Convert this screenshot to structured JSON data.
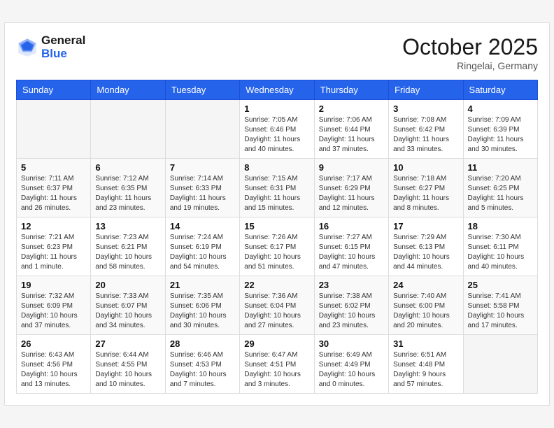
{
  "header": {
    "logo_line1": "General",
    "logo_line2": "Blue",
    "month_title": "October 2025",
    "location": "Ringelai, Germany"
  },
  "weekdays": [
    "Sunday",
    "Monday",
    "Tuesday",
    "Wednesday",
    "Thursday",
    "Friday",
    "Saturday"
  ],
  "weeks": [
    [
      {
        "day": "",
        "info": ""
      },
      {
        "day": "",
        "info": ""
      },
      {
        "day": "",
        "info": ""
      },
      {
        "day": "1",
        "info": "Sunrise: 7:05 AM\nSunset: 6:46 PM\nDaylight: 11 hours\nand 40 minutes."
      },
      {
        "day": "2",
        "info": "Sunrise: 7:06 AM\nSunset: 6:44 PM\nDaylight: 11 hours\nand 37 minutes."
      },
      {
        "day": "3",
        "info": "Sunrise: 7:08 AM\nSunset: 6:42 PM\nDaylight: 11 hours\nand 33 minutes."
      },
      {
        "day": "4",
        "info": "Sunrise: 7:09 AM\nSunset: 6:39 PM\nDaylight: 11 hours\nand 30 minutes."
      }
    ],
    [
      {
        "day": "5",
        "info": "Sunrise: 7:11 AM\nSunset: 6:37 PM\nDaylight: 11 hours\nand 26 minutes."
      },
      {
        "day": "6",
        "info": "Sunrise: 7:12 AM\nSunset: 6:35 PM\nDaylight: 11 hours\nand 23 minutes."
      },
      {
        "day": "7",
        "info": "Sunrise: 7:14 AM\nSunset: 6:33 PM\nDaylight: 11 hours\nand 19 minutes."
      },
      {
        "day": "8",
        "info": "Sunrise: 7:15 AM\nSunset: 6:31 PM\nDaylight: 11 hours\nand 15 minutes."
      },
      {
        "day": "9",
        "info": "Sunrise: 7:17 AM\nSunset: 6:29 PM\nDaylight: 11 hours\nand 12 minutes."
      },
      {
        "day": "10",
        "info": "Sunrise: 7:18 AM\nSunset: 6:27 PM\nDaylight: 11 hours\nand 8 minutes."
      },
      {
        "day": "11",
        "info": "Sunrise: 7:20 AM\nSunset: 6:25 PM\nDaylight: 11 hours\nand 5 minutes."
      }
    ],
    [
      {
        "day": "12",
        "info": "Sunrise: 7:21 AM\nSunset: 6:23 PM\nDaylight: 11 hours\nand 1 minute."
      },
      {
        "day": "13",
        "info": "Sunrise: 7:23 AM\nSunset: 6:21 PM\nDaylight: 10 hours\nand 58 minutes."
      },
      {
        "day": "14",
        "info": "Sunrise: 7:24 AM\nSunset: 6:19 PM\nDaylight: 10 hours\nand 54 minutes."
      },
      {
        "day": "15",
        "info": "Sunrise: 7:26 AM\nSunset: 6:17 PM\nDaylight: 10 hours\nand 51 minutes."
      },
      {
        "day": "16",
        "info": "Sunrise: 7:27 AM\nSunset: 6:15 PM\nDaylight: 10 hours\nand 47 minutes."
      },
      {
        "day": "17",
        "info": "Sunrise: 7:29 AM\nSunset: 6:13 PM\nDaylight: 10 hours\nand 44 minutes."
      },
      {
        "day": "18",
        "info": "Sunrise: 7:30 AM\nSunset: 6:11 PM\nDaylight: 10 hours\nand 40 minutes."
      }
    ],
    [
      {
        "day": "19",
        "info": "Sunrise: 7:32 AM\nSunset: 6:09 PM\nDaylight: 10 hours\nand 37 minutes."
      },
      {
        "day": "20",
        "info": "Sunrise: 7:33 AM\nSunset: 6:07 PM\nDaylight: 10 hours\nand 34 minutes."
      },
      {
        "day": "21",
        "info": "Sunrise: 7:35 AM\nSunset: 6:06 PM\nDaylight: 10 hours\nand 30 minutes."
      },
      {
        "day": "22",
        "info": "Sunrise: 7:36 AM\nSunset: 6:04 PM\nDaylight: 10 hours\nand 27 minutes."
      },
      {
        "day": "23",
        "info": "Sunrise: 7:38 AM\nSunset: 6:02 PM\nDaylight: 10 hours\nand 23 minutes."
      },
      {
        "day": "24",
        "info": "Sunrise: 7:40 AM\nSunset: 6:00 PM\nDaylight: 10 hours\nand 20 minutes."
      },
      {
        "day": "25",
        "info": "Sunrise: 7:41 AM\nSunset: 5:58 PM\nDaylight: 10 hours\nand 17 minutes."
      }
    ],
    [
      {
        "day": "26",
        "info": "Sunrise: 6:43 AM\nSunset: 4:56 PM\nDaylight: 10 hours\nand 13 minutes."
      },
      {
        "day": "27",
        "info": "Sunrise: 6:44 AM\nSunset: 4:55 PM\nDaylight: 10 hours\nand 10 minutes."
      },
      {
        "day": "28",
        "info": "Sunrise: 6:46 AM\nSunset: 4:53 PM\nDaylight: 10 hours\nand 7 minutes."
      },
      {
        "day": "29",
        "info": "Sunrise: 6:47 AM\nSunset: 4:51 PM\nDaylight: 10 hours\nand 3 minutes."
      },
      {
        "day": "30",
        "info": "Sunrise: 6:49 AM\nSunset: 4:49 PM\nDaylight: 10 hours\nand 0 minutes."
      },
      {
        "day": "31",
        "info": "Sunrise: 6:51 AM\nSunset: 4:48 PM\nDaylight: 9 hours\nand 57 minutes."
      },
      {
        "day": "",
        "info": ""
      }
    ]
  ]
}
